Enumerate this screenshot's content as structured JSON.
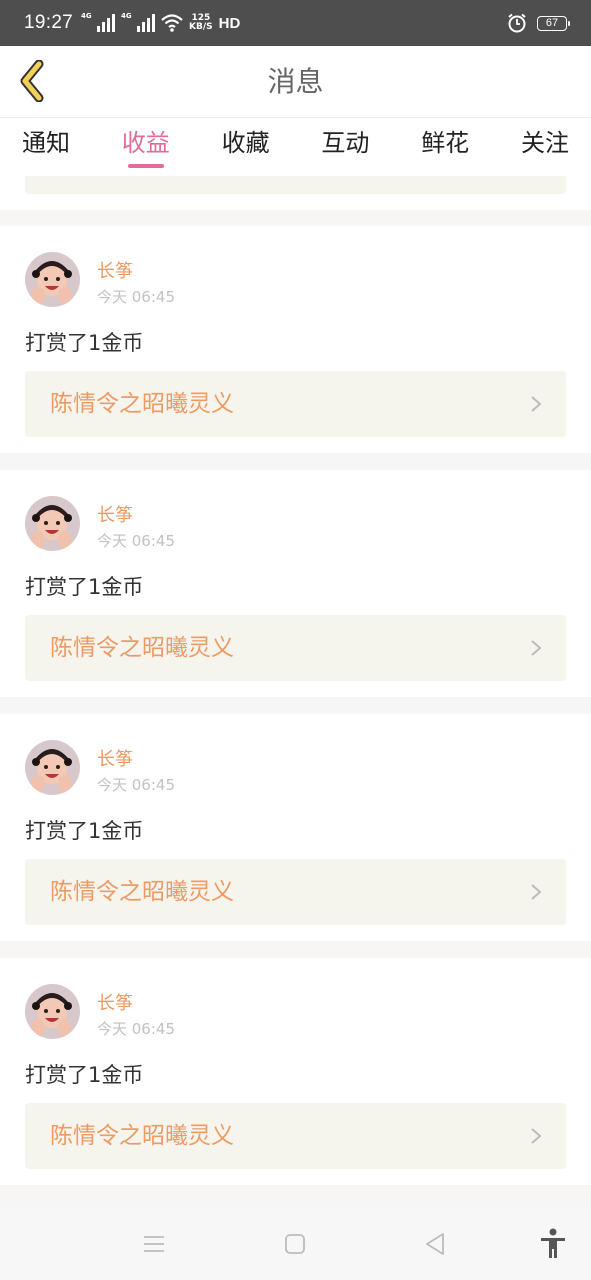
{
  "status_bar": {
    "time": "19:27",
    "signal_tag_1": "4G",
    "signal_tag_2": "4G",
    "speed_value": "125",
    "speed_unit": "KB/S",
    "hd_label": "HD",
    "battery": "67"
  },
  "header": {
    "title": "消息"
  },
  "tabs": [
    {
      "label": "通知",
      "active": false
    },
    {
      "label": "收益",
      "active": true
    },
    {
      "label": "收藏",
      "active": false
    },
    {
      "label": "互动",
      "active": false
    },
    {
      "label": "鲜花",
      "active": false
    },
    {
      "label": "关注",
      "active": false
    }
  ],
  "items": [
    {
      "user": "长筝",
      "time": "今天 06:45",
      "action": "打赏了1金币",
      "work": "陈情令之昭曦灵义"
    },
    {
      "user": "长筝",
      "time": "今天 06:45",
      "action": "打赏了1金币",
      "work": "陈情令之昭曦灵义"
    },
    {
      "user": "长筝",
      "time": "今天 06:45",
      "action": "打赏了1金币",
      "work": "陈情令之昭曦灵义"
    },
    {
      "user": "长筝",
      "time": "今天 06:45",
      "action": "打赏了1金币",
      "work": "陈情令之昭曦灵义"
    }
  ],
  "colors": {
    "accent_pink": "#e06b9c",
    "username_orange": "#ee9a62",
    "back_arrow_yellow": "#f2d15a"
  },
  "icons": {
    "back": "chevron-left-icon",
    "link": "chevron-right-icon",
    "nav": [
      "menu-icon",
      "home-square-icon",
      "back-triangle-icon",
      "accessibility-icon"
    ]
  }
}
